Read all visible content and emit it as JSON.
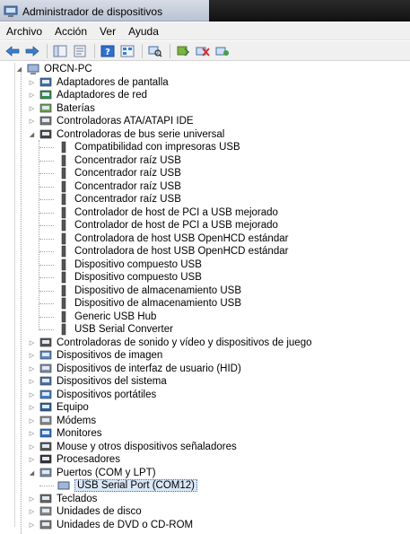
{
  "window": {
    "title": "Administrador de dispositivos"
  },
  "menu": {
    "items": [
      "Archivo",
      "Acción",
      "Ver",
      "Ayuda"
    ]
  },
  "toolbar": {
    "buttons": [
      "back-arrow-icon",
      "forward-arrow-icon",
      "console-tree-icon",
      "properties-icon",
      "help-icon",
      "view-icon",
      "scan-hardware-icon",
      "update-driver-icon",
      "disable-device-icon",
      "uninstall-device-icon"
    ]
  },
  "tree": {
    "root": "ORCN-PC",
    "categories": [
      {
        "label": "Adaptadores de pantalla"
      },
      {
        "label": "Adaptadores de red"
      },
      {
        "label": "Baterías"
      },
      {
        "label": "Controladoras ATA/ATAPI IDE"
      },
      {
        "label": "Controladoras de bus serie universal",
        "expanded": true,
        "children": [
          "Compatibilidad con impresoras USB",
          "Concentrador raíz USB",
          "Concentrador raíz USB",
          "Concentrador raíz USB",
          "Concentrador raíz USB",
          "Controlador de host de PCI a USB mejorado",
          "Controlador de host de PCI a USB mejorado",
          "Controladora de host USB OpenHCD estándar",
          "Controladora de host USB OpenHCD estándar",
          "Dispositivo compuesto USB",
          "Dispositivo compuesto USB",
          "Dispositivo de almacenamiento USB",
          "Dispositivo de almacenamiento USB",
          "Generic USB Hub",
          "USB Serial Converter"
        ]
      },
      {
        "label": "Controladoras de sonido y vídeo y dispositivos de juego"
      },
      {
        "label": "Dispositivos de imagen"
      },
      {
        "label": "Dispositivos de interfaz de usuario (HID)"
      },
      {
        "label": "Dispositivos del sistema"
      },
      {
        "label": "Dispositivos portátiles"
      },
      {
        "label": "Equipo"
      },
      {
        "label": "Módems"
      },
      {
        "label": "Monitores"
      },
      {
        "label": "Mouse y otros dispositivos señaladores"
      },
      {
        "label": "Procesadores"
      },
      {
        "label": "Puertos (COM y LPT)",
        "expanded": true,
        "children": [
          "USB Serial Port (COM12)"
        ]
      },
      {
        "label": "Teclados"
      },
      {
        "label": "Unidades de disco"
      },
      {
        "label": "Unidades de DVD o CD-ROM"
      }
    ],
    "selected": "USB Serial Port (COM12)"
  }
}
